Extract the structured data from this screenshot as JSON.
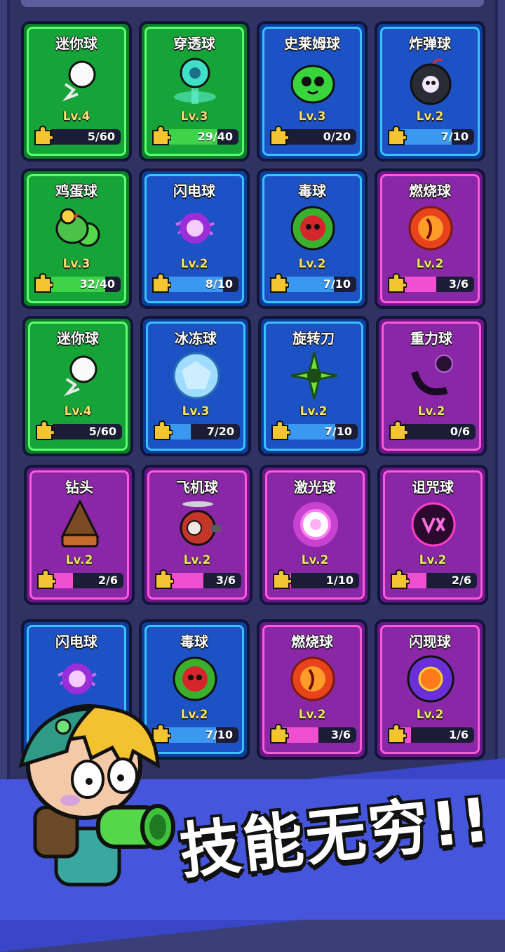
{
  "cards": [
    {
      "name": "迷你球",
      "level": "Lv.4",
      "count": "5/60",
      "progress": 0.08,
      "color": "green",
      "icon": "white-ball-icon"
    },
    {
      "name": "穿透球",
      "level": "Lv.3",
      "count": "29/40",
      "progress": 0.72,
      "color": "green",
      "icon": "piercing-ball-icon"
    },
    {
      "name": "史莱姆球",
      "level": "Lv.3",
      "count": "0/20",
      "progress": 0.0,
      "color": "blue",
      "icon": "slime-ball-icon"
    },
    {
      "name": "炸弹球",
      "level": "Lv.2",
      "count": "7/10",
      "progress": 0.7,
      "color": "blue",
      "icon": "bomb-ball-icon"
    },
    {
      "name": "鸡蛋球",
      "level": "Lv.3",
      "count": "32/40",
      "progress": 0.8,
      "color": "green",
      "icon": "chicken-egg-ball-icon"
    },
    {
      "name": "闪电球",
      "level": "Lv.2",
      "count": "8/10",
      "progress": 0.8,
      "color": "blue",
      "icon": "lightning-ball-icon"
    },
    {
      "name": "毒球",
      "level": "Lv.2",
      "count": "7/10",
      "progress": 0.7,
      "color": "blue",
      "icon": "poison-ball-icon"
    },
    {
      "name": "燃烧球",
      "level": "Lv.2",
      "count": "3/6",
      "progress": 0.5,
      "color": "purple",
      "icon": "fire-ball-icon"
    },
    {
      "name": "迷你球",
      "level": "Lv.4",
      "count": "5/60",
      "progress": 0.08,
      "color": "green",
      "icon": "white-ball-icon"
    },
    {
      "name": "冰冻球",
      "level": "Lv.3",
      "count": "7/20",
      "progress": 0.35,
      "color": "blue",
      "icon": "ice-ball-icon"
    },
    {
      "name": "旋转刀",
      "level": "Lv.2",
      "count": "7/10",
      "progress": 0.7,
      "color": "blue",
      "icon": "spinning-blade-icon"
    },
    {
      "name": "重力球",
      "level": "Lv.2",
      "count": "0/6",
      "progress": 0.0,
      "color": "purple",
      "icon": "gravity-ball-icon"
    },
    {
      "name": "钻头",
      "level": "Lv.2",
      "count": "2/6",
      "progress": 0.33,
      "color": "purple",
      "icon": "drill-icon"
    },
    {
      "name": "飞机球",
      "level": "Lv.2",
      "count": "3/6",
      "progress": 0.5,
      "color": "purple",
      "icon": "airplane-ball-icon"
    },
    {
      "name": "激光球",
      "level": "Lv.2",
      "count": "1/10",
      "progress": 0.1,
      "color": "purple",
      "icon": "laser-ball-icon"
    },
    {
      "name": "诅咒球",
      "level": "Lv.2",
      "count": "2/6",
      "progress": 0.33,
      "color": "purple",
      "icon": "curse-ball-icon"
    },
    {
      "name": "闪电球",
      "level": "",
      "count": "",
      "progress": 0.0,
      "color": "blue",
      "icon": "lightning-ball-icon"
    },
    {
      "name": "毒球",
      "level": "Lv.2",
      "count": "7/10",
      "progress": 0.7,
      "color": "blue",
      "icon": "poison-ball-icon"
    },
    {
      "name": "燃烧球",
      "level": "Lv.2",
      "count": "3/6",
      "progress": 0.5,
      "color": "purple",
      "icon": "fire-ball-icon"
    },
    {
      "name": "闪现球",
      "level": "Lv.2",
      "count": "1/6",
      "progress": 0.17,
      "color": "purple",
      "icon": "flash-ball-icon"
    }
  ],
  "slogan": "技能无穷!!"
}
